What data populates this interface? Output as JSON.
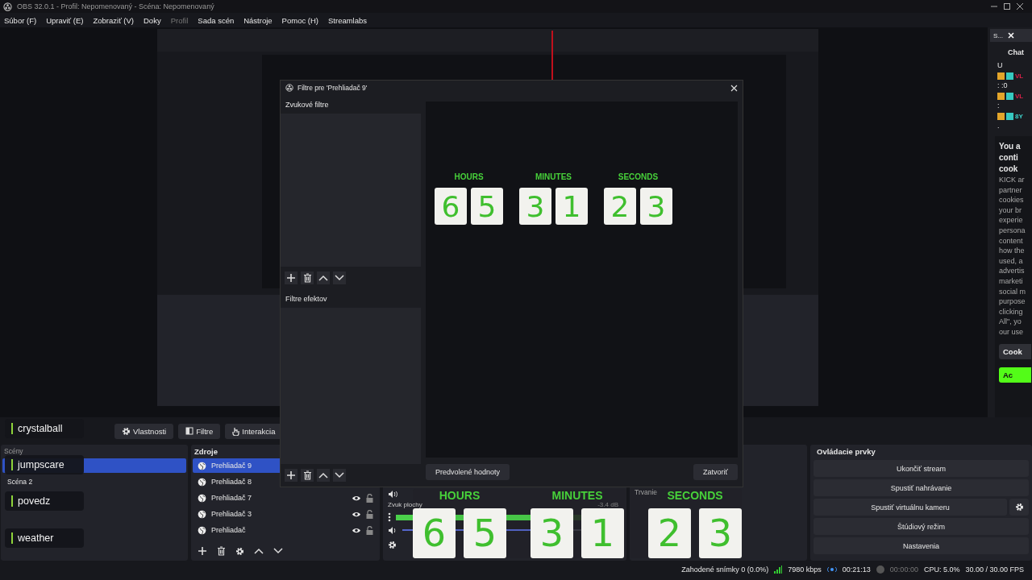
{
  "window": {
    "title": "OBS 32.0.1 - Profil: Nepomenovaný - Scéna: Nepomenovaný"
  },
  "menu": [
    {
      "label": "Súbor (F)",
      "disabled": false
    },
    {
      "label": "Upraviť (E)",
      "disabled": false
    },
    {
      "label": "Zobraziť (V)",
      "disabled": false
    },
    {
      "label": "Doky",
      "disabled": false
    },
    {
      "label": "Profil",
      "disabled": true
    },
    {
      "label": "Sada scén",
      "disabled": false
    },
    {
      "label": "Nástroje",
      "disabled": false
    },
    {
      "label": "Pomoc (H)",
      "disabled": false
    },
    {
      "label": "Streamlabs",
      "disabled": false
    }
  ],
  "source_toolbar": [
    {
      "label": "Vlastnosti",
      "kind": "gear"
    },
    {
      "label": "Filtre",
      "kind": "filter"
    },
    {
      "label": "Interakcia",
      "kind": "hand"
    }
  ],
  "scenes": {
    "title": "Scény",
    "items": [
      {
        "selected": true
      },
      {
        "label": "Scéna 2",
        "selected": false
      }
    ]
  },
  "sources": {
    "title": "Zdroje",
    "items": [
      {
        "label": "Prehliadač 9",
        "selected": true
      },
      {
        "label": "Prehliadač 8",
        "selected": false
      },
      {
        "label": "Prehliadač 7",
        "selected": false
      },
      {
        "label": "Prehliadač 3",
        "selected": false
      },
      {
        "label": "Prehliadač",
        "selected": false
      }
    ]
  },
  "mixer": {
    "channel": "Zvuk plochy",
    "reading": "-3.4 dB",
    "level": 0.78,
    "volume": {
      "level": 0.64
    }
  },
  "transitions": {
    "duration_label": "Trvanie"
  },
  "controls": {
    "title": "Ovládacie prvky",
    "buttons": [
      {
        "label": "Ukončiť stream",
        "kind": "plain"
      },
      {
        "label": "Spustiť nahrávanie",
        "kind": "plain"
      },
      {
        "label": "Spustiť virtuálnu kameru",
        "kind": "with-settings"
      },
      {
        "label": "Štúdiový režim",
        "kind": "plain"
      },
      {
        "label": "Nastavenia",
        "kind": "plain"
      }
    ]
  },
  "status_bar": {
    "dropped": "Zahodené snímky 0 (0.0%)",
    "bitrate": "7980 kbps",
    "stream_time": "00:21:13",
    "record_time": "00:00:00",
    "cpu": "CPU: 5.0%",
    "fps": "30.00 / 30.00 FPS"
  },
  "chat": {
    "tab": "S...",
    "title": "Chat",
    "first_line": "U",
    "messages": [
      {
        "name": "VL",
        "color": "#e0204a",
        "text": ": :0"
      },
      {
        "name": "VL",
        "color": "#e0204a",
        "text": ":"
      },
      {
        "name": "8Y",
        "color": "#3fd0c8",
        "text": "."
      }
    ],
    "cookie_heading": [
      "You a",
      "conti",
      "cook"
    ],
    "cookie_body": [
      "KICK ar",
      "partner",
      "cookies",
      "your br",
      "experie",
      "persona",
      "content",
      "how the",
      "used, a",
      "advertis",
      "marketi",
      "social m",
      "purpose",
      "clicking",
      "All\", yo",
      "our use"
    ],
    "cookie_buttons": [
      "Cook",
      "Ac"
    ]
  },
  "dialog": {
    "title": "Filtre pre 'Prehliadač 9'",
    "audio_filters_label": "Zvukové filtre",
    "effect_filters_label": "Filtre efektov",
    "timer": [
      {
        "label": "HOURS",
        "digits": [
          "6",
          "5"
        ]
      },
      {
        "label": "MINUTES",
        "digits": [
          "3",
          "1"
        ]
      },
      {
        "label": "SECONDS",
        "digits": [
          "2",
          "3"
        ]
      }
    ],
    "buttons": [
      "Predvolené hodnoty",
      "Zatvoriť"
    ]
  },
  "alerts": [
    "crystalball",
    "jumpscare",
    "povedz",
    "weather"
  ],
  "timer_overlay": [
    {
      "label": "HOURS",
      "digits": [
        "6",
        "5"
      ]
    },
    {
      "label": "MINUTES",
      "digits": [
        "3",
        "1"
      ]
    },
    {
      "label": "SECONDS",
      "digits": [
        "2",
        "3"
      ]
    }
  ]
}
